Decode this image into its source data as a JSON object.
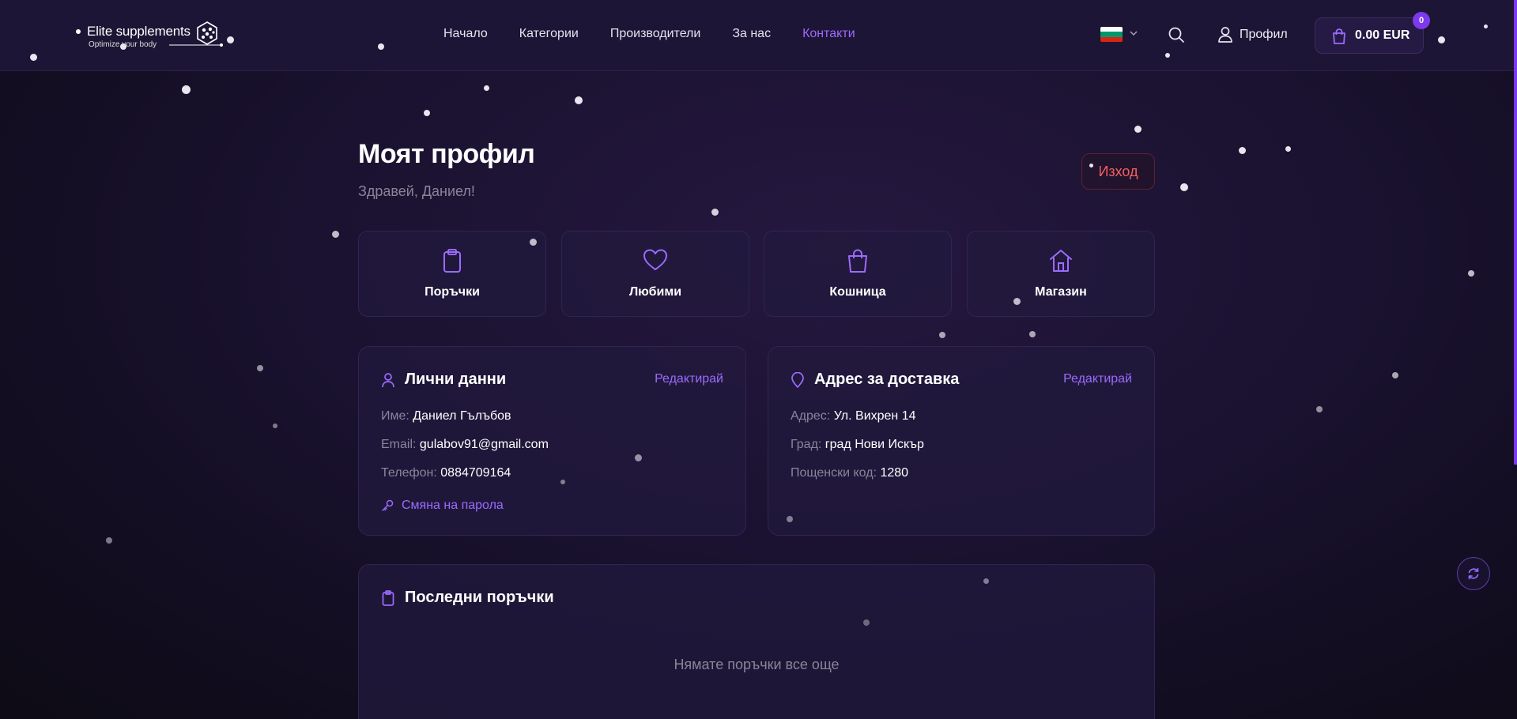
{
  "brand": {
    "name": "Elite supplements",
    "tagline": "Optimize your body"
  },
  "nav": {
    "items": [
      {
        "label": "Начало"
      },
      {
        "label": "Категории"
      },
      {
        "label": "Производители"
      },
      {
        "label": "За нас"
      },
      {
        "label": "Контакти"
      }
    ],
    "active": "Контакти"
  },
  "header": {
    "profile_label": "Профил",
    "cart_total": "0.00 EUR",
    "cart_count": "0"
  },
  "page": {
    "title": "Моят профил",
    "greeting": "Здравей, Даниел!",
    "logout_label": "Изход"
  },
  "quick_links": [
    {
      "label": "Поръчки",
      "icon": "clipboard-icon"
    },
    {
      "label": "Любими",
      "icon": "heart-icon"
    },
    {
      "label": "Кошница",
      "icon": "shopping-bag-icon"
    },
    {
      "label": "Магазин",
      "icon": "home-icon"
    }
  ],
  "personal": {
    "title": "Лични данни",
    "edit_label": "Редактирай",
    "name_label": "Име:",
    "name_value": "Даниел Гълъбов",
    "email_label": "Email:",
    "email_value": "gulabov91@gmail.com",
    "phone_label": "Телефон:",
    "phone_value": "0884709164",
    "change_password_label": "Смяна на парола"
  },
  "address": {
    "title": "Адрес за доставка",
    "edit_label": "Редактирай",
    "street_label": "Адрес:",
    "street_value": "Ул. Вихрен 14",
    "city_label": "Град:",
    "city_value": "град Нови Искър",
    "zip_label": "Пощенски код:",
    "zip_value": "1280"
  },
  "orders": {
    "title": "Последни поръчки",
    "empty_text": "Нямате поръчки все още"
  },
  "colors": {
    "accent": "#9b6bff",
    "badge": "#7c3aed",
    "danger": "#f25f5f",
    "flag_white": "#ffffff",
    "flag_green": "#00966e",
    "flag_red": "#d62612"
  }
}
